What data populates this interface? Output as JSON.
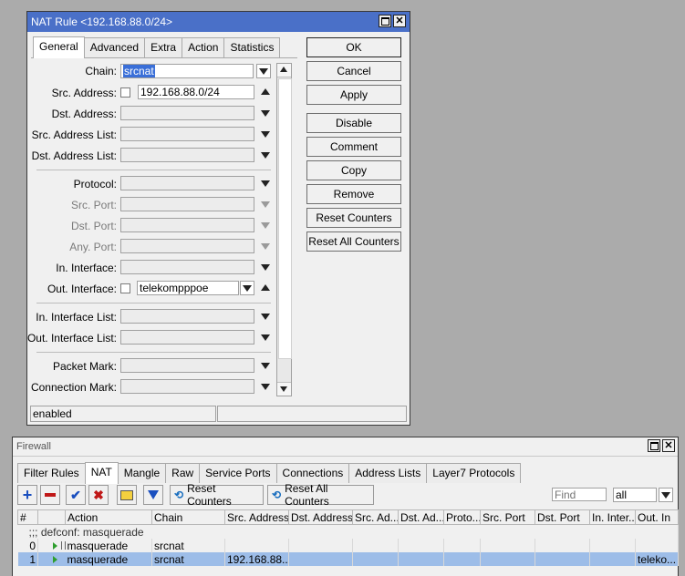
{
  "dialog": {
    "title": "NAT Rule <192.168.88.0/24>",
    "tabs": [
      "General",
      "Advanced",
      "Extra",
      "Action",
      "Statistics"
    ],
    "fields": {
      "chain": {
        "label": "Chain:",
        "value": "srcnat"
      },
      "src_address": {
        "label": "Src. Address:",
        "value": "192.168.88.0/24"
      },
      "dst_address": {
        "label": "Dst. Address:",
        "value": ""
      },
      "src_address_list": {
        "label": "Src. Address List:",
        "value": ""
      },
      "dst_address_list": {
        "label": "Dst. Address List:",
        "value": ""
      },
      "protocol": {
        "label": "Protocol:",
        "value": ""
      },
      "src_port": {
        "label": "Src. Port:",
        "value": ""
      },
      "dst_port": {
        "label": "Dst. Port:",
        "value": ""
      },
      "any_port": {
        "label": "Any. Port:",
        "value": ""
      },
      "in_interface": {
        "label": "In. Interface:",
        "value": ""
      },
      "out_interface": {
        "label": "Out. Interface:",
        "value": "telekompppoe"
      },
      "in_interface_list": {
        "label": "In. Interface List:",
        "value": ""
      },
      "out_interface_list": {
        "label": "Out. Interface List:",
        "value": ""
      },
      "packet_mark": {
        "label": "Packet Mark:",
        "value": ""
      },
      "connection_mark": {
        "label": "Connection Mark:",
        "value": ""
      }
    },
    "buttons": {
      "ok": "OK",
      "cancel": "Cancel",
      "apply": "Apply",
      "disable": "Disable",
      "comment": "Comment",
      "copy": "Copy",
      "remove": "Remove",
      "reset_counters": "Reset Counters",
      "reset_all_counters": "Reset All Counters"
    },
    "status": "enabled"
  },
  "firewall": {
    "title": "Firewall",
    "tabs": [
      "Filter Rules",
      "NAT",
      "Mangle",
      "Raw",
      "Service Ports",
      "Connections",
      "Address Lists",
      "Layer7 Protocols"
    ],
    "toolbar": {
      "reset_counters": "Reset Counters",
      "reset_all_counters": "Reset All Counters",
      "find_placeholder": "Find",
      "filter_value": "all"
    },
    "columns": [
      "#",
      "Action",
      "Chain",
      "Src. Address",
      "Dst. Address",
      "Src. Ad...",
      "Dst. Ad...",
      "Proto...",
      "Src. Port",
      "Dst. Port",
      "In. Inter...",
      "Out. In"
    ],
    "comment_row": ";;; defconf: masquerade",
    "rows": [
      {
        "num": "0",
        "action": "masquerade",
        "chain": "srcnat",
        "src": "",
        "out": ""
      },
      {
        "num": "1",
        "action": "masquerade",
        "chain": "srcnat",
        "src": "192.168.88...",
        "out": "teleko..."
      }
    ]
  },
  "colors": {
    "titlebar_active": "#4a70c8",
    "selected_row": "#9dbde8",
    "add_icon": "#1a4fbf",
    "remove_icon": "#c01818"
  }
}
